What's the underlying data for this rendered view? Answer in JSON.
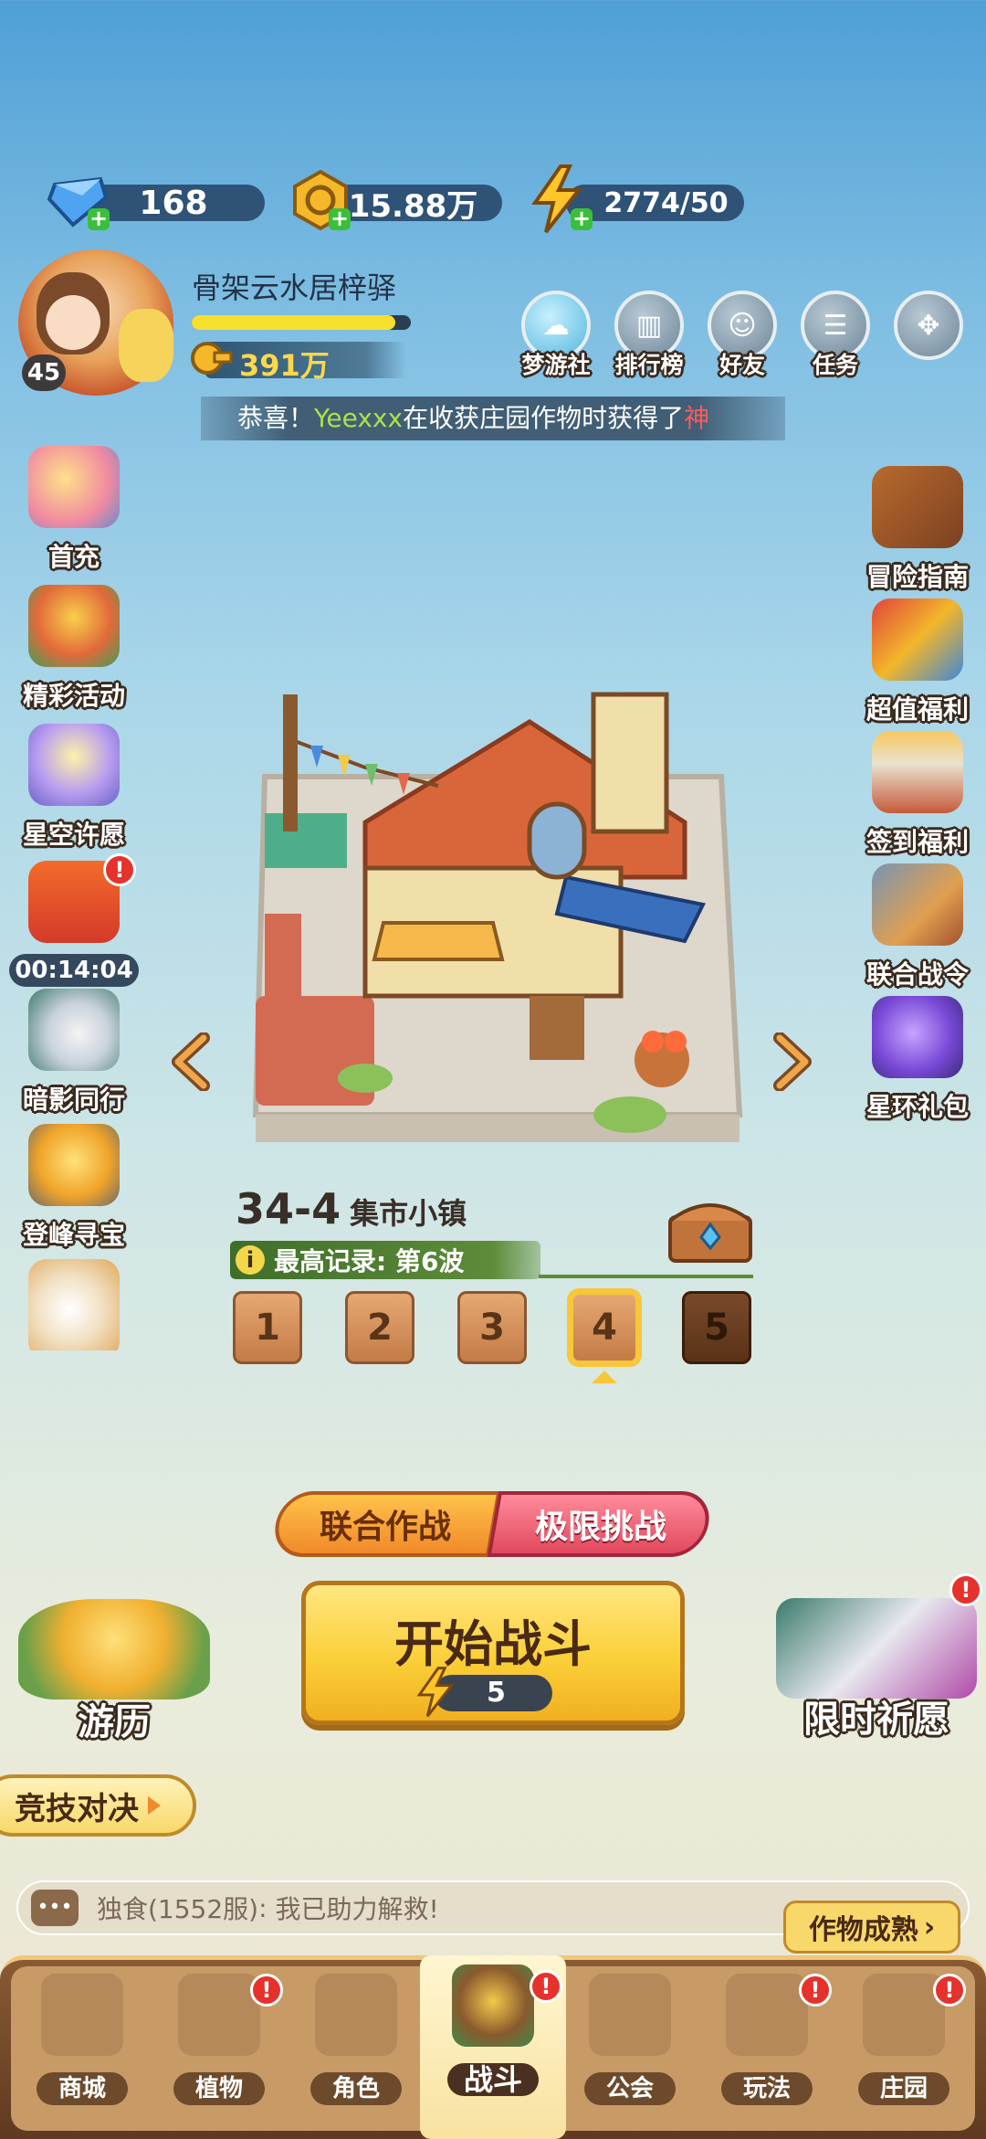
{
  "currencies": {
    "diamonds": "168",
    "coins": "15.88万",
    "energy": "2774/50"
  },
  "player": {
    "name": "骨架云水居梓驿",
    "level": "45",
    "power": "391万",
    "exp_fill": 0.93
  },
  "social": [
    {
      "label": "梦游社",
      "icon": "dream-club-icon"
    },
    {
      "label": "排行榜",
      "icon": "leaderboard-icon"
    },
    {
      "label": "好友",
      "icon": "friends-icon"
    },
    {
      "label": "任务",
      "icon": "tasks-icon"
    },
    {
      "label": "",
      "icon": "more-menu-icon"
    }
  ],
  "marquee": {
    "prefix": "恭喜！",
    "user": "Yeexxx",
    "text": "在收获庄园作物时获得了",
    "highlight": "神"
  },
  "left_menu": [
    {
      "label": "首充",
      "icon": "first-recharge-icon"
    },
    {
      "label": "精彩活动",
      "icon": "events-icon"
    },
    {
      "label": "星空许愿",
      "icon": "starry-wish-icon"
    },
    {
      "label": "00:14:04",
      "icon": "gift-timer-icon"
    },
    {
      "label": "暗影同行",
      "icon": "shadow-companion-icon"
    },
    {
      "label": "登峰寻宝",
      "icon": "summit-treasure-icon"
    }
  ],
  "right_menu": [
    {
      "label": "冒险指南",
      "icon": "adventure-guide-icon"
    },
    {
      "label": "超值福利",
      "icon": "value-bonus-icon"
    },
    {
      "label": "签到福利",
      "icon": "checkin-bonus-icon"
    },
    {
      "label": "联合战令",
      "icon": "battle-pass-icon"
    },
    {
      "label": "星环礼包",
      "icon": "star-ring-pack-icon"
    }
  ],
  "stage": {
    "number": "34-4",
    "name": "集市小镇",
    "record": "最高记录: 第6波",
    "buttons": [
      "1",
      "2",
      "3",
      "4",
      "5"
    ],
    "selected": 3
  },
  "modes": {
    "coop": "联合作战",
    "extreme": "极限挑战"
  },
  "start": {
    "label": "开始战斗",
    "cost": "5"
  },
  "side_features": {
    "travel": "游历",
    "limited_prayer": "限时祈愿",
    "arena": "竞技对决"
  },
  "chat": {
    "sender": "独食(1552服)",
    "message": "我已助力解救!"
  },
  "crop_notice": "作物成熟",
  "nav": [
    {
      "label": "商城",
      "icon": "shop-icon",
      "alert": false
    },
    {
      "label": "植物",
      "icon": "plants-icon",
      "alert": true
    },
    {
      "label": "角色",
      "icon": "characters-icon",
      "alert": false
    },
    {
      "label": "战斗",
      "icon": "battle-icon",
      "alert": true
    },
    {
      "label": "公会",
      "icon": "guild-icon",
      "alert": false
    },
    {
      "label": "玩法",
      "icon": "gameplay-icon",
      "alert": true
    },
    {
      "label": "庄园",
      "icon": "manor-icon",
      "alert": true
    }
  ],
  "colors": {
    "accent_orange": "#f6a62a",
    "accent_pink": "#e85a6b",
    "start_yellow": "#fbd54a",
    "nav_brown": "#6d4a2c",
    "alert_red": "#e5322d"
  }
}
